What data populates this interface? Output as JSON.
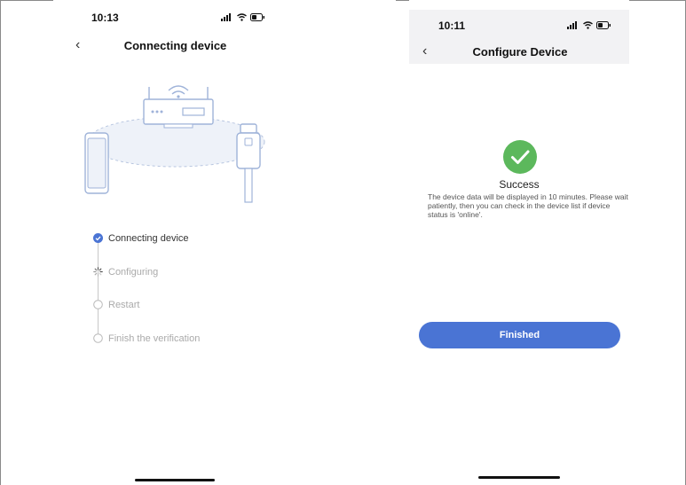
{
  "left_screen": {
    "status": {
      "time": "10:13"
    },
    "nav": {
      "title": "Connecting device"
    },
    "steps": [
      {
        "label": "Connecting device",
        "state": "done"
      },
      {
        "label": "Configuring",
        "state": "loading"
      },
      {
        "label": "Restart",
        "state": "pending"
      },
      {
        "label": "Finish the verification",
        "state": "pending"
      }
    ]
  },
  "right_screen": {
    "status": {
      "time": "10:11"
    },
    "nav": {
      "title": "Configure Device"
    },
    "result": {
      "title": "Success",
      "message": "The device data will be displayed in 10 minutes. Please wait patiently, then you can check in the device list if device status is 'online'."
    },
    "finished_label": "Finished"
  },
  "colors": {
    "accent": "#4a74d4",
    "success": "#5cb85c",
    "step_done": "#333333",
    "step_pending": "#aaaaaa",
    "illustration": "#9fb3d9"
  }
}
